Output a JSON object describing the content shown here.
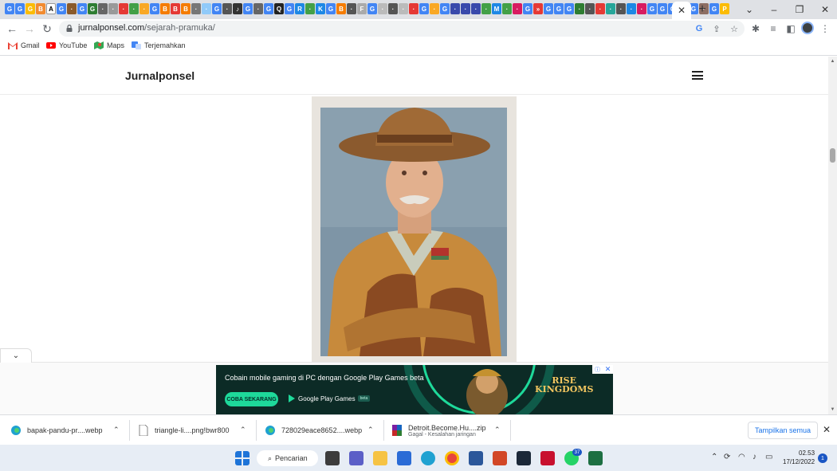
{
  "browser": {
    "active_tab_close": "✕",
    "new_tab": "+",
    "window": {
      "minimize": "–",
      "restore": "❐",
      "close": "✕",
      "dropdown": "⌄"
    },
    "url": {
      "domain": "jurnalponsel.com",
      "path": "/sejarah-pramuka/"
    }
  },
  "bookmarks": [
    {
      "label": "Gmail",
      "icon": "gmail-icon",
      "color": "#ea4335"
    },
    {
      "label": "YouTube",
      "icon": "youtube-icon",
      "color": "#ff0000"
    },
    {
      "label": "Maps",
      "icon": "maps-icon",
      "color": "#34a853"
    },
    {
      "label": "Terjemahkan",
      "icon": "translate-icon",
      "color": "#4285f4"
    }
  ],
  "site": {
    "title": "Jurnalponsel"
  },
  "ad": {
    "headline": "Cobain mobile gaming di PC dengan Google Play Games beta",
    "cta": "COBA SEKARANG",
    "brand": "Google Play Games",
    "beta_tag": "beta",
    "game_logo_line1": "RISE",
    "game_logo_line2": "KINGDOMS",
    "info": "ⓘ",
    "close": "✕"
  },
  "downloads": {
    "items": [
      {
        "name": "bapak-pandu-pr....webp",
        "icon": "edge-icon",
        "sub": ""
      },
      {
        "name": "triangle-li....png!bwr800",
        "icon": "file-icon",
        "sub": ""
      },
      {
        "name": "728029eace8652....webp",
        "icon": "edge-icon",
        "sub": ""
      },
      {
        "name": "Detroit.Become.Hu....zip",
        "icon": "winrar-icon",
        "sub": "Gagal - Kesalahan jaringan"
      }
    ],
    "show_all": "Tampilkan semua",
    "close": "✕"
  },
  "taskbar": {
    "search_label": "Pencarian",
    "whatsapp_badge": "37",
    "time": "02.53",
    "date": "17/12/2022",
    "notification_count": "1"
  }
}
